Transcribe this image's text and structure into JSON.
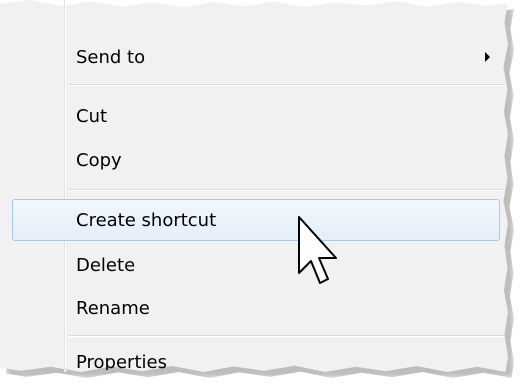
{
  "context_menu": {
    "items": [
      {
        "label": "Send to",
        "has_submenu": true
      },
      {
        "label": "Cut"
      },
      {
        "label": "Copy"
      },
      {
        "label": "Create shortcut",
        "highlighted": true
      },
      {
        "label": "Delete"
      },
      {
        "label": "Rename"
      },
      {
        "label": "Properties"
      }
    ]
  },
  "icons": {
    "submenu": "chevron-right-icon",
    "cursor": "mouse-pointer-icon"
  },
  "colors": {
    "menu_background": "#f1f1f1",
    "highlight_border": "#a8c8ec",
    "highlight_fill": "#e4eefa"
  }
}
